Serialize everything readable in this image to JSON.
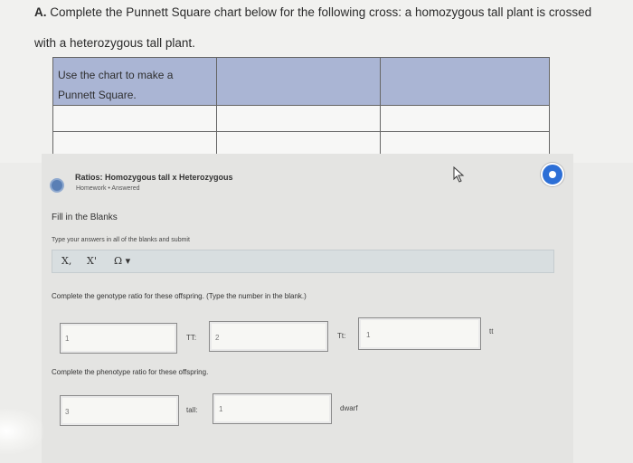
{
  "question": {
    "label": "A.",
    "line1": "Complete the Punnett Square chart below for the following cross:  a homozygous tall plant is crossed",
    "line2": "with a heterozygous tall plant."
  },
  "punnett_chart": {
    "label_line1": "Use the chart to make a",
    "label_line2": "Punnett Square."
  },
  "homework": {
    "title": "Ratios: Homozygous tall x Heterozygous",
    "type": "Homework",
    "status": "Answered",
    "status_color": "#2d6fd6"
  },
  "fill_title": "Fill in the Blanks",
  "instructions": "Type your answers in all of the blanks and submit",
  "toolbar": {
    "subscript": "X,",
    "superscript": "X'",
    "symbols": "Ω ▾"
  },
  "genotype": {
    "prompt": "Complete the genotype ratio for these offspring. (Type the number in the blank.)",
    "blank1": "1",
    "label1": "TT:",
    "blank2": "2",
    "label2": "Tt:",
    "blank3": "1",
    "label3": "tt"
  },
  "phenotype": {
    "prompt": "Complete the phenotype ratio for these offspring.",
    "blank1": "3",
    "label1": "tall:",
    "blank2": "1",
    "label2": "dwarf"
  }
}
